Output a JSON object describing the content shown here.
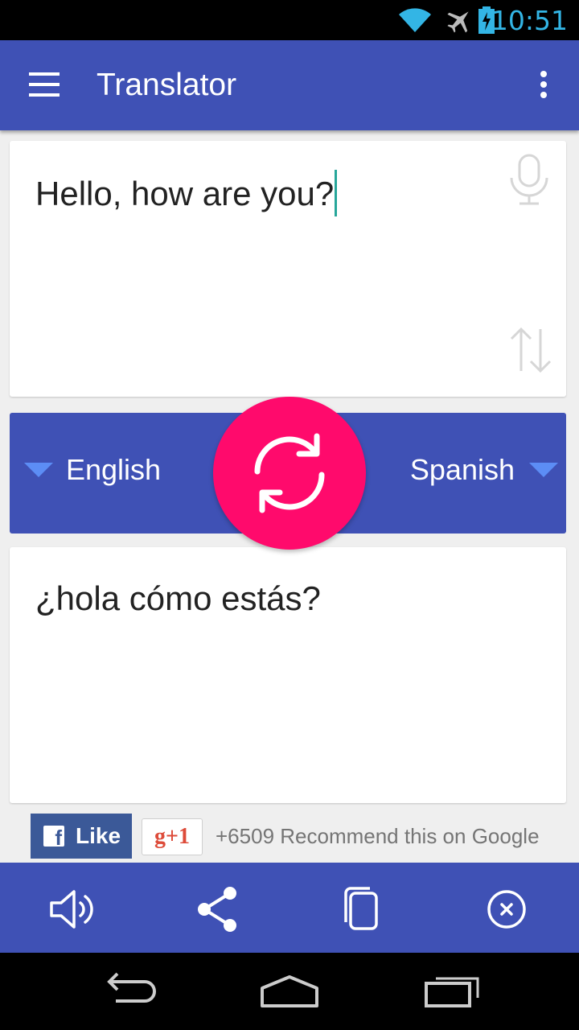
{
  "status_bar": {
    "time": "10:51",
    "icons": [
      "wifi-icon",
      "airplane-icon",
      "battery-charging-icon"
    ],
    "time_color": "#33b5e5"
  },
  "app_bar": {
    "title": "Translator",
    "menu_icon": "hamburger-menu-icon",
    "overflow_icon": "overflow-menu-icon",
    "color": "#3f51b5"
  },
  "input": {
    "text": "Hello, how are you?",
    "mic_icon": "microphone-icon",
    "swap_icon": "swap-vertical-icon"
  },
  "languages": {
    "source": "English",
    "target": "Spanish",
    "translate_icon": "refresh-icon",
    "fab_color": "#ff0a6c"
  },
  "output": {
    "text": "¿hola cómo estás?"
  },
  "social": {
    "facebook_like_label": "Like",
    "gplus_label": "g+1",
    "gplus_count_text": "+6509 Recommend this on Google"
  },
  "actions": {
    "icons": [
      "speaker-icon",
      "share-icon",
      "copy-icon",
      "clear-icon"
    ]
  },
  "nav_bar": {
    "icons": [
      "back-icon",
      "home-icon",
      "recent-apps-icon"
    ]
  }
}
